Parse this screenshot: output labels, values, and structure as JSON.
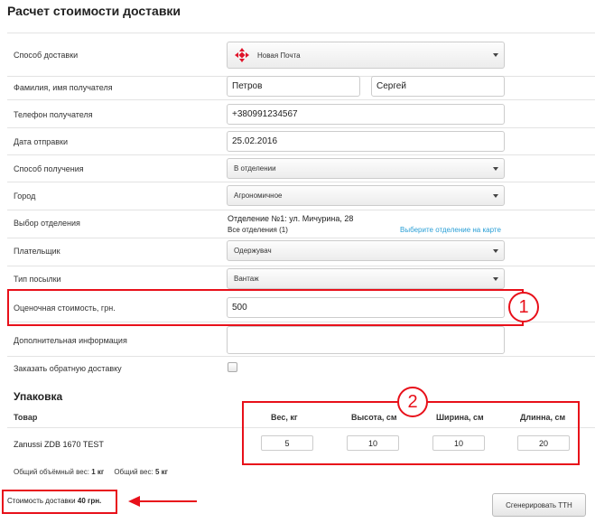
{
  "page": {
    "title": "Расчет стоимости доставки"
  },
  "form": {
    "delivery_method": {
      "label": "Способ доставки",
      "value": "Новая Почта"
    },
    "recipient_name": {
      "label": "Фамилия, имя получателя",
      "last_name": "Петров",
      "first_name": "Сергей"
    },
    "recipient_phone": {
      "label": "Телефон получателя",
      "value": "+380991234567"
    },
    "send_date": {
      "label": "Дата отправки",
      "value": "25.02.2016"
    },
    "receive_method": {
      "label": "Способ получения",
      "value": "В отделении"
    },
    "city": {
      "label": "Город",
      "value": "Агрономичное"
    },
    "branch": {
      "label": "Выбор отделения",
      "selected": "Отделение №1: ул. Мичурина, 28",
      "count": "Все отделения (1)",
      "map_link": "Выберите отделение на карте"
    },
    "payer": {
      "label": "Плательщик",
      "value": "Одержувач"
    },
    "parcel_type": {
      "label": "Тип посылки",
      "value": "Вантаж"
    },
    "declared_value": {
      "label": "Оценочная стоимость, грн.",
      "value": "500"
    },
    "additional_info": {
      "label": "Дополнительная информация",
      "value": ""
    },
    "return_delivery": {
      "label": "Заказать обратную доставку",
      "checked": false
    }
  },
  "packaging": {
    "title": "Упаковка",
    "columns": [
      "Товар",
      "Вес, кг",
      "Высота, см",
      "Ширина, см",
      "Длинна, см"
    ],
    "rows": [
      {
        "product": "Zanussi ZDB 1670 TEST",
        "weight": "5",
        "height": "10",
        "width": "10",
        "length": "20"
      }
    ],
    "volume_weight_label": "Общий объёмный вес:",
    "volume_weight_value": "1 кг",
    "total_weight_label": "Общий вес:",
    "total_weight_value": "5 кг"
  },
  "summary": {
    "cost_label": "Стоимость доставки",
    "cost_value": "40 грн."
  },
  "actions": {
    "generate_label": "Сгенерировать ТТН"
  },
  "annotations": {
    "marker_1": "1",
    "marker_2": "2"
  },
  "colors": {
    "annotation": "#e8101a",
    "link": "#2a9fd6",
    "nova_poshta": "#e0152b"
  }
}
